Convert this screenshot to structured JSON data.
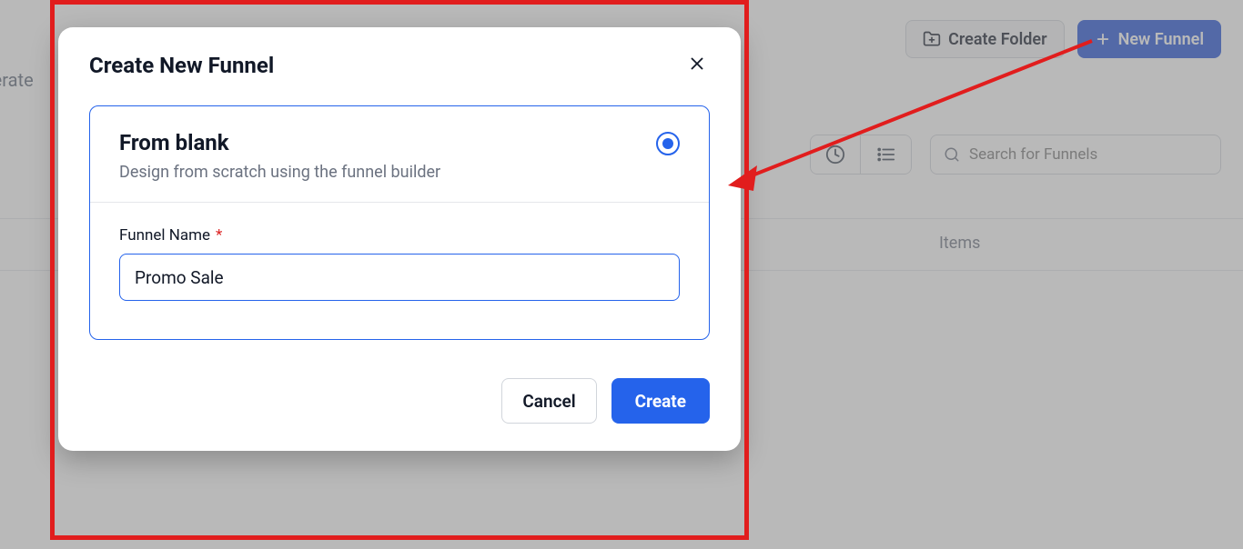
{
  "background": {
    "partial_text": "enerate",
    "toolbar": {
      "create_folder": "Create Folder",
      "new_funnel": "New Funnel"
    },
    "search_placeholder": "Search for Funnels",
    "band_items_label": "Items"
  },
  "modal": {
    "title": "Create New Funnel",
    "option": {
      "title": "From blank",
      "subtitle": "Design from scratch using the funnel builder"
    },
    "form": {
      "funnel_name_label": "Funnel Name",
      "funnel_name_value": "Promo Sale"
    },
    "actions": {
      "cancel": "Cancel",
      "create": "Create"
    }
  }
}
